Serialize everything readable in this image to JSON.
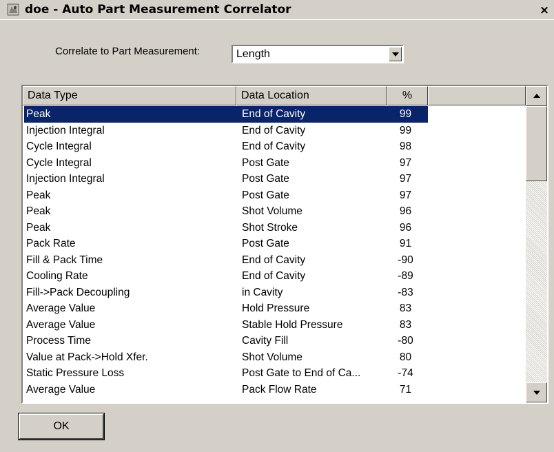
{
  "window": {
    "title": "doe - Auto Part Measurement Correlator",
    "close_label": "×",
    "icon": "app-icon"
  },
  "correlate": {
    "label": "Correlate to Part Measurement:",
    "value": "Length"
  },
  "table": {
    "columns": [
      "Data Type",
      "Data Location",
      "%",
      ""
    ],
    "rows": [
      {
        "type": "Peak",
        "location": "End of Cavity",
        "pct": "99",
        "selected": true
      },
      {
        "type": "Injection Integral",
        "location": "End of Cavity",
        "pct": "99"
      },
      {
        "type": "Cycle Integral",
        "location": "End of Cavity",
        "pct": "98"
      },
      {
        "type": "Cycle Integral",
        "location": "Post Gate",
        "pct": "97"
      },
      {
        "type": "Injection Integral",
        "location": "Post Gate",
        "pct": "97"
      },
      {
        "type": "Peak",
        "location": "Post Gate",
        "pct": "97"
      },
      {
        "type": "Peak",
        "location": "Shot Volume",
        "pct": "96"
      },
      {
        "type": "Peak",
        "location": "Shot Stroke",
        "pct": "96"
      },
      {
        "type": "Pack Rate",
        "location": "Post Gate",
        "pct": "91"
      },
      {
        "type": "Fill & Pack Time",
        "location": "End of Cavity",
        "pct": "-90"
      },
      {
        "type": "Cooling Rate",
        "location": "End of Cavity",
        "pct": "-89"
      },
      {
        "type": "Fill->Pack Decoupling",
        "location": "in Cavity",
        "pct": "-83"
      },
      {
        "type": "Average Value",
        "location": "Hold Pressure",
        "pct": "83"
      },
      {
        "type": "Average Value",
        "location": "Stable Hold Pressure",
        "pct": "83"
      },
      {
        "type": "Process Time",
        "location": "Cavity Fill",
        "pct": "-80"
      },
      {
        "type": "Value at Pack->Hold Xfer.",
        "location": "Shot Volume",
        "pct": "80"
      },
      {
        "type": "Static Pressure Loss",
        "location": "Post Gate to End of Ca...",
        "pct": "-74"
      },
      {
        "type": "Average Value",
        "location": "Pack Flow Rate",
        "pct": "71"
      }
    ]
  },
  "buttons": {
    "ok": "OK"
  },
  "colors": {
    "face": "#d4d0c8",
    "selection": "#0a246a"
  }
}
